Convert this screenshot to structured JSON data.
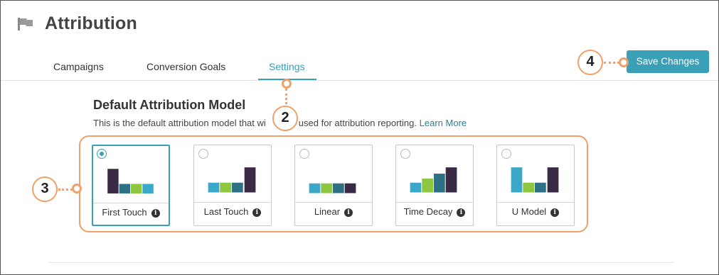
{
  "app": {
    "title": "Attribution",
    "icon": "flag-icon"
  },
  "tabs": [
    {
      "label": "Campaigns",
      "active": false
    },
    {
      "label": "Conversion Goals",
      "active": false
    },
    {
      "label": "Settings",
      "active": true
    }
  ],
  "toolbar": {
    "save_label": "Save Changes"
  },
  "section": {
    "heading": "Default Attribution Model",
    "description_before": "This is the default attribution model that wi",
    "description_after": "used for attribution reporting.",
    "learn_more": "Learn More"
  },
  "models": [
    {
      "label": "First Touch",
      "selected": true,
      "info_icon": "info-icon"
    },
    {
      "label": "Last Touch",
      "selected": false,
      "info_icon": "info-icon"
    },
    {
      "label": "Linear",
      "selected": false,
      "info_icon": "info-icon"
    },
    {
      "label": "Time Decay",
      "selected": false,
      "info_icon": "info-icon"
    },
    {
      "label": "U Model",
      "selected": false,
      "info_icon": "info-icon"
    }
  ],
  "callouts": [
    "2",
    "3",
    "4"
  ],
  "colors": {
    "accent": "#3aa0b8",
    "callout": "#f0a068",
    "bar_blue": "#3aa8c8",
    "bar_green": "#8dc63f",
    "bar_teal": "#2e7186",
    "bar_dark": "#3b2a45"
  }
}
